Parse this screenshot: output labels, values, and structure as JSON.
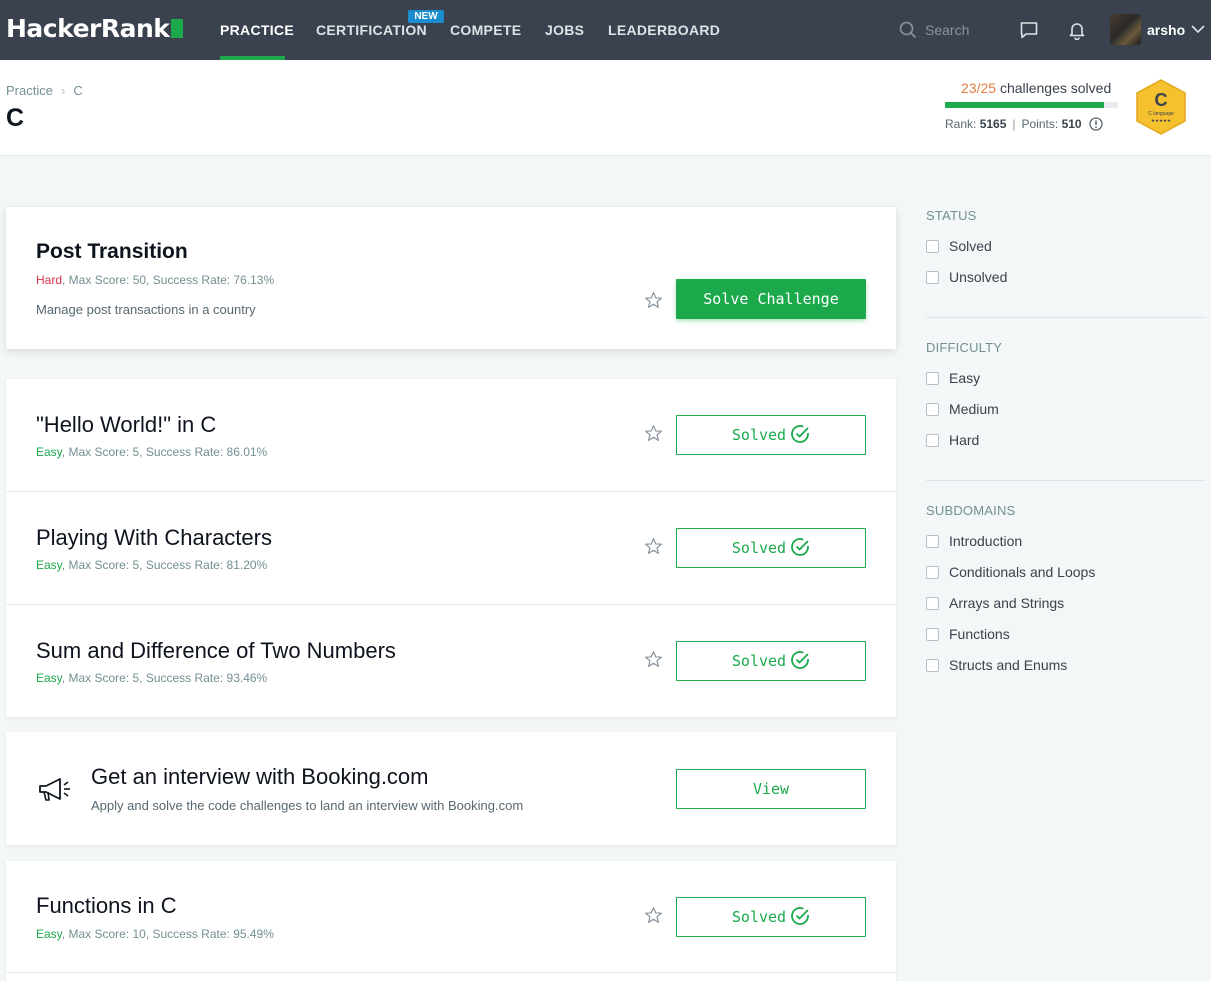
{
  "nav": {
    "logo": "HackerRank",
    "items": [
      "PRACTICE",
      "CERTIFICATION",
      "COMPETE",
      "JOBS",
      "LEADERBOARD"
    ],
    "new_badge": "NEW",
    "search_placeholder": "Search",
    "username": "arsho"
  },
  "header": {
    "breadcrumb": [
      "Practice",
      "C"
    ],
    "title": "C",
    "solved_count": "23/25",
    "solved_label": "challenges solved",
    "progress_fraction": 0.92,
    "rank_label": "Rank:",
    "rank_value": "5165",
    "points_label": "Points:",
    "points_value": "510",
    "badge_letter": "C",
    "badge_name": "C language",
    "badge_stars": "★★★★★"
  },
  "challenges": [
    {
      "title": "Post Transition",
      "difficulty": "Hard",
      "meta": ", Max Score: 50, Success Rate: 76.13%",
      "description": "Manage post transactions in a country",
      "button": "Solve Challenge"
    },
    {
      "title": "\"Hello World!\" in C",
      "difficulty": "Easy",
      "meta": ", Max Score: 5, Success Rate: 86.01%",
      "button": "Solved"
    },
    {
      "title": "Playing With Characters",
      "difficulty": "Easy",
      "meta": ", Max Score: 5, Success Rate: 81.20%",
      "button": "Solved"
    },
    {
      "title": "Sum and Difference of Two Numbers",
      "difficulty": "Easy",
      "meta": ", Max Score: 5, Success Rate: 93.46%",
      "button": "Solved"
    },
    {
      "title": "Functions in C",
      "difficulty": "Easy",
      "meta": ", Max Score: 10, Success Rate: 95.49%",
      "button": "Solved"
    }
  ],
  "promo": {
    "title": "Get an interview with Booking.com",
    "subtitle": "Apply and solve the code challenges to land an interview with Booking.com",
    "button": "View"
  },
  "sidebar": {
    "status_heading": "STATUS",
    "status": [
      "Solved",
      "Unsolved"
    ],
    "difficulty_heading": "DIFFICULTY",
    "difficulty": [
      "Easy",
      "Medium",
      "Hard"
    ],
    "subdomains_heading": "SUBDOMAINS",
    "subdomains": [
      "Introduction",
      "Conditionals and Loops",
      "Arrays and Strings",
      "Functions",
      "Structs and Enums"
    ]
  },
  "colors": {
    "brand_green": "#1ba94c",
    "nav_bg": "#39424e",
    "hard": "#d9334a",
    "badge_gold": "#f5c12e"
  }
}
